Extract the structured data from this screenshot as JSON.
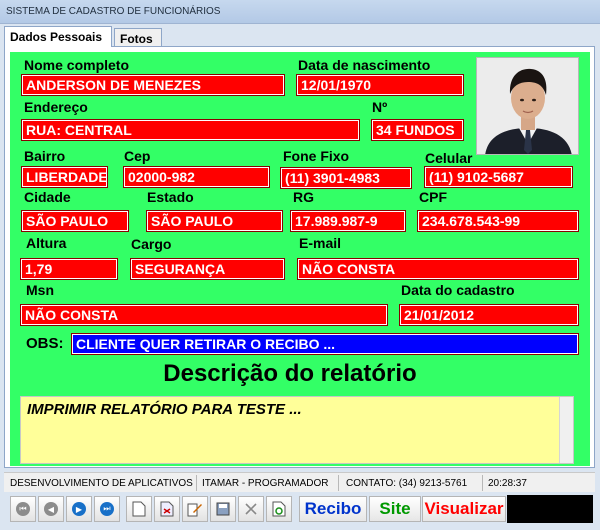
{
  "window": {
    "title": "SISTEMA DE CADASTRO DE FUNCIONÁRIOS"
  },
  "tabs": [
    {
      "label": "Dados Pessoais"
    },
    {
      "label": "Fotos"
    }
  ],
  "form": {
    "nome": {
      "label": "Nome completo",
      "value": "ANDERSON DE MENEZES"
    },
    "nascimento": {
      "label": "Data de nascimento",
      "value": "12/01/1970"
    },
    "endereco": {
      "label": "Endereço",
      "value": "RUA: CENTRAL"
    },
    "numero": {
      "label": "Nº",
      "value": "34 FUNDOS"
    },
    "bairro": {
      "label": "Bairro",
      "value": "LIBERDADE"
    },
    "cep": {
      "label": "Cep",
      "value": "02000-982"
    },
    "fone": {
      "label": "Fone Fixo",
      "value": "(11) 3901-4983"
    },
    "celular": {
      "label": "Celular",
      "value": "(11) 9102-5687"
    },
    "cidade": {
      "label": "Cidade",
      "value": "SÃO PAULO"
    },
    "estado": {
      "label": "Estado",
      "value": "SÃO PAULO"
    },
    "rg": {
      "label": "RG",
      "value": "17.989.987-9"
    },
    "cpf": {
      "label": "CPF",
      "value": "234.678.543-99"
    },
    "altura": {
      "label": "Altura",
      "value": "1,79"
    },
    "cargo": {
      "label": "Cargo",
      "value": "SEGURANÇA"
    },
    "email": {
      "label": "E-mail",
      "value": "NÃO CONSTA"
    },
    "msn": {
      "label": "Msn",
      "value": "NÃO CONSTA"
    },
    "cadastro": {
      "label": "Data do cadastro",
      "value": "21/01/2012"
    },
    "obs": {
      "label": "OBS:",
      "value": "CLIENTE QUER RETIRAR O RECIBO ..."
    }
  },
  "report": {
    "heading": "Descrição do relatório",
    "text": "IMPRIMIR RELATÓRIO PARA TESTE ..."
  },
  "status": {
    "s1": "DESENVOLVIMENTO DE APLICATIVOS",
    "s2": "ITAMAR - PROGRAMADOR",
    "s3": "CONTATO: (34) 9213-5761",
    "s4": "20:28:37"
  },
  "toolbar": {
    "recibo": "Recibo",
    "site": "Site",
    "visualizar": "Visualizar"
  },
  "colors": {
    "form_bg": "#33ff66",
    "field_bg": "#ff0000",
    "obs_bg": "#0000ff",
    "report_bg": "#ffff99",
    "recibo": "#0033cc",
    "site": "#009900",
    "visualizar": "#ff0000"
  }
}
